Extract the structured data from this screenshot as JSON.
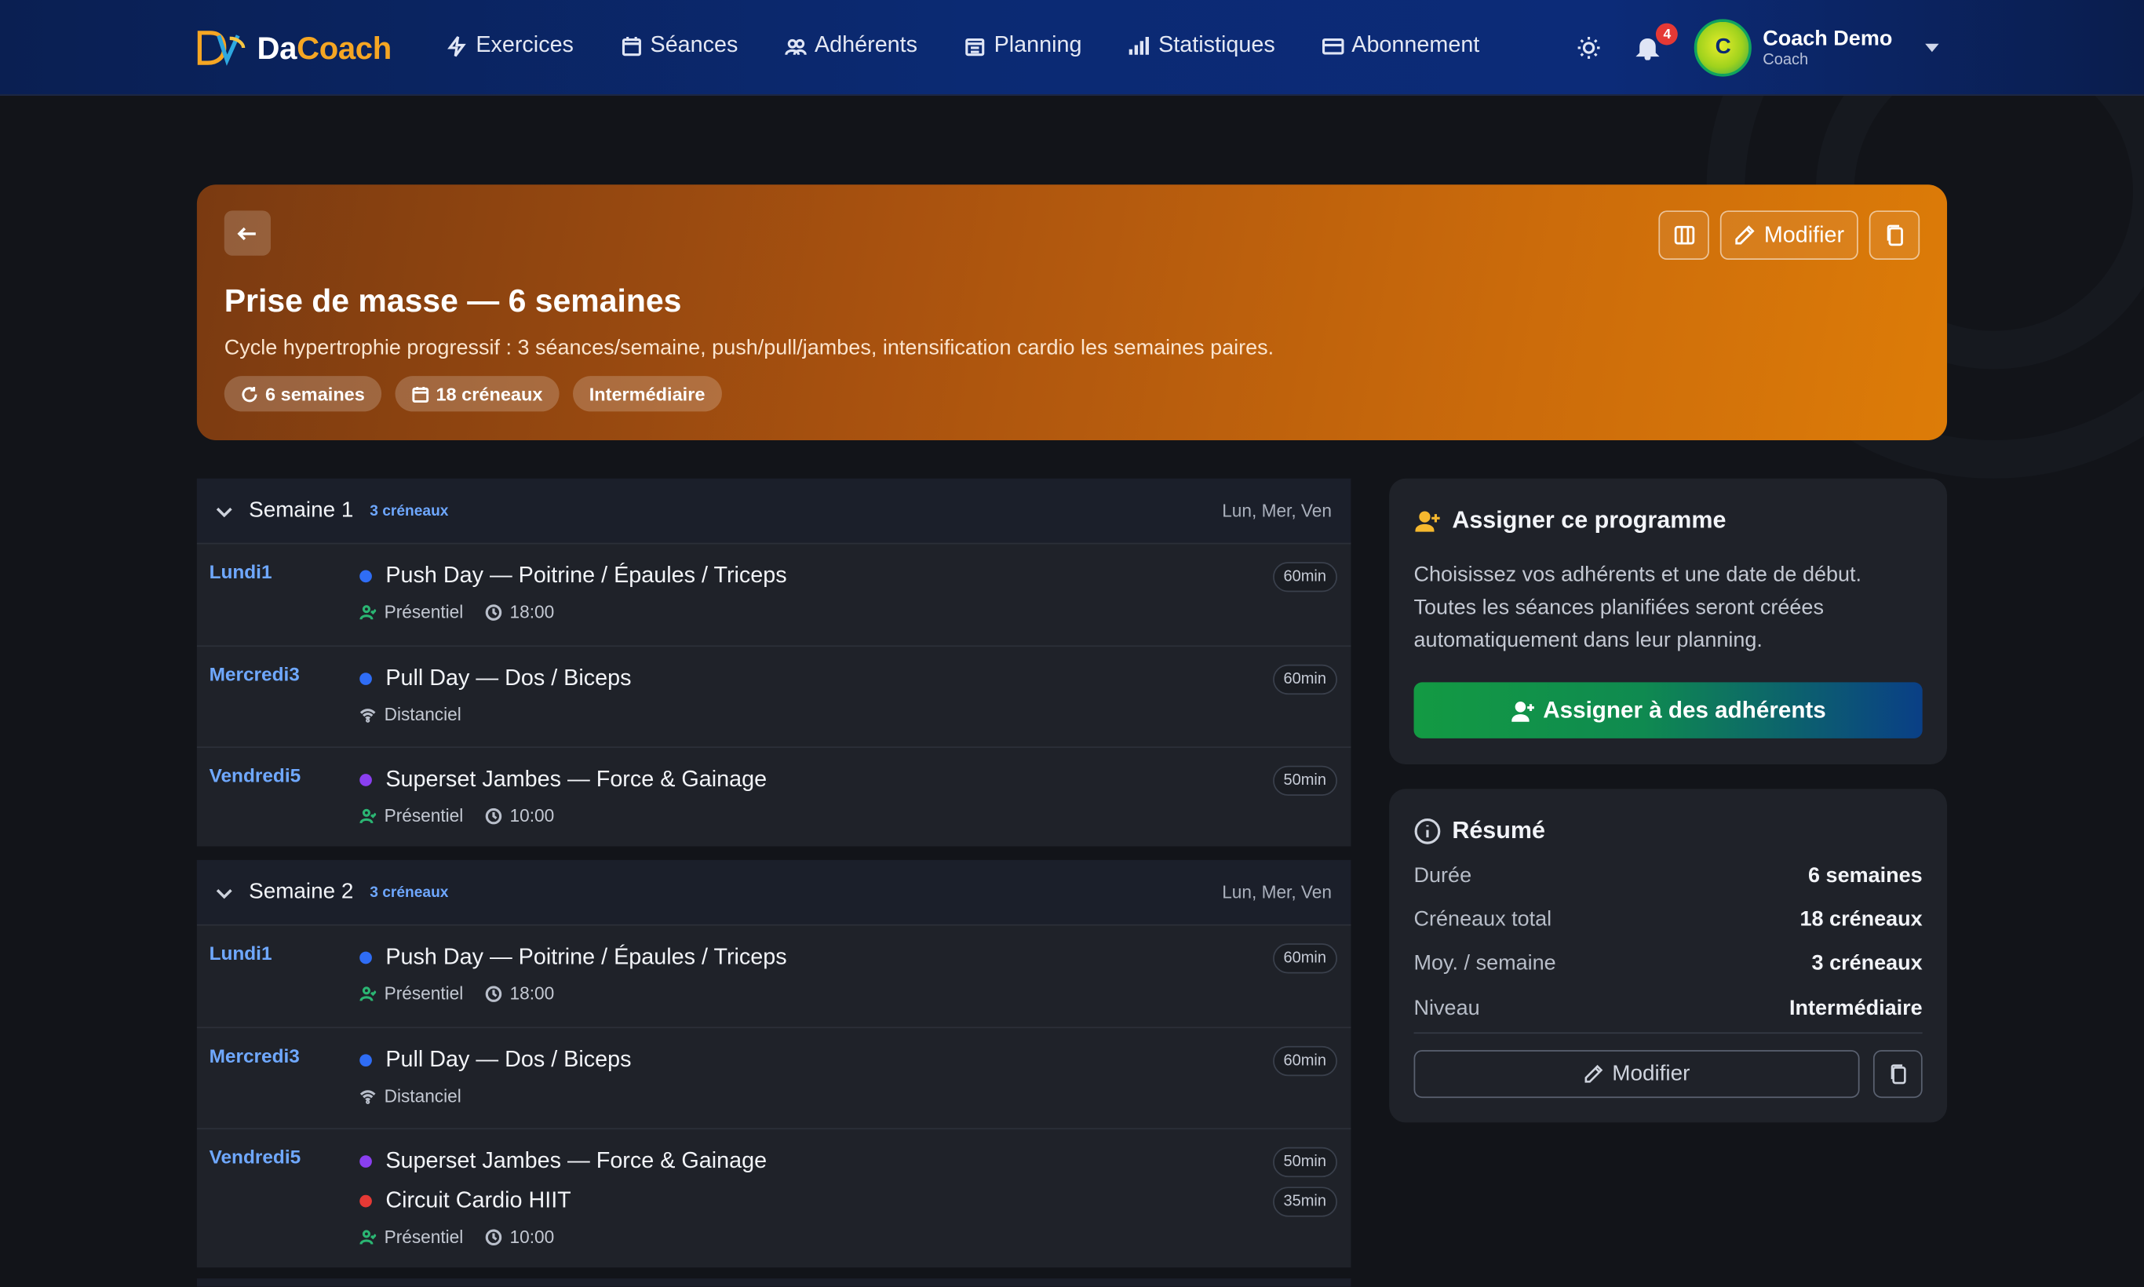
{
  "nav": {
    "brand_prefix": "Da",
    "brand_rest": "Coach",
    "items": [
      {
        "label": "Exercices",
        "icon": "bolt-icon"
      },
      {
        "label": "Séances",
        "icon": "calendar-check-icon"
      },
      {
        "label": "Adhérents",
        "icon": "users-icon"
      },
      {
        "label": "Planning",
        "icon": "calendar-grid-icon"
      },
      {
        "label": "Statistiques",
        "icon": "bar-chart-icon"
      },
      {
        "label": "Abonnement",
        "icon": "credit-card-icon"
      }
    ],
    "notifications": "4",
    "user_initial": "C",
    "user_name": "Coach Demo",
    "user_role": "Coach"
  },
  "program": {
    "title": "Prise de masse — 6 semaines",
    "description": "Cycle hypertrophie progressif : 3 séances/semaine, push/pull/jambes, intensification cardio les semaines paires.",
    "tags": [
      "6 semaines",
      "18 créneaux",
      "Intermédiaire"
    ],
    "edit_label": "Modifier"
  },
  "weeks": [
    {
      "title": "Semaine 1",
      "count": "3 créneaux",
      "days": "Lun, Mer, Ven",
      "slots": [
        {
          "day": "Lundi1",
          "sessions": [
            {
              "name": "Push Day — Poitrine / Épaules / Triceps",
              "duration": "60min",
              "color": "#2f6df5"
            }
          ],
          "mode": "Présentiel",
          "time": "18:00"
        },
        {
          "day": "Mercredi3",
          "sessions": [
            {
              "name": "Pull Day — Dos / Biceps",
              "duration": "60min",
              "color": "#2f6df5"
            }
          ],
          "mode": "Distanciel",
          "time": ""
        },
        {
          "day": "Vendredi5",
          "sessions": [
            {
              "name": "Superset Jambes — Force & Gainage",
              "duration": "50min",
              "color": "#8a3ff0"
            }
          ],
          "mode": "Présentiel",
          "time": "10:00"
        }
      ]
    },
    {
      "title": "Semaine 2",
      "count": "3 créneaux",
      "days": "Lun, Mer, Ven",
      "slots": [
        {
          "day": "Lundi1",
          "sessions": [
            {
              "name": "Push Day — Poitrine / Épaules / Triceps",
              "duration": "60min",
              "color": "#2f6df5"
            }
          ],
          "mode": "Présentiel",
          "time": "18:00"
        },
        {
          "day": "Mercredi3",
          "sessions": [
            {
              "name": "Pull Day — Dos / Biceps",
              "duration": "60min",
              "color": "#2f6df5"
            }
          ],
          "mode": "Distanciel",
          "time": ""
        },
        {
          "day": "Vendredi5",
          "sessions": [
            {
              "name": "Superset Jambes — Force & Gainage",
              "duration": "50min",
              "color": "#8a3ff0"
            },
            {
              "name": "Circuit Cardio HIIT",
              "duration": "35min",
              "color": "#e53935"
            }
          ],
          "mode": "Présentiel",
          "time": "10:00"
        }
      ]
    }
  ],
  "assign": {
    "title": "Assigner ce programme",
    "description": "Choisissez vos adhérents et une date de début. Toutes les séances planifiées seront créées automatiquement dans leur planning.",
    "button": "Assigner à des adhérents"
  },
  "summary": {
    "title": "Résumé",
    "rows": [
      {
        "key": "Durée",
        "value": "6 semaines"
      },
      {
        "key": "Créneaux total",
        "value": "18 créneaux"
      },
      {
        "key": "Moy. / semaine",
        "value": "3 créneaux"
      },
      {
        "key": "Niveau",
        "value": "Intermédiaire"
      }
    ],
    "edit_label": "Modifier"
  },
  "colors": {
    "accent_blue": "#6fa8ff",
    "hero_orange": "#dd7c08",
    "assign_green": "#139a43"
  }
}
